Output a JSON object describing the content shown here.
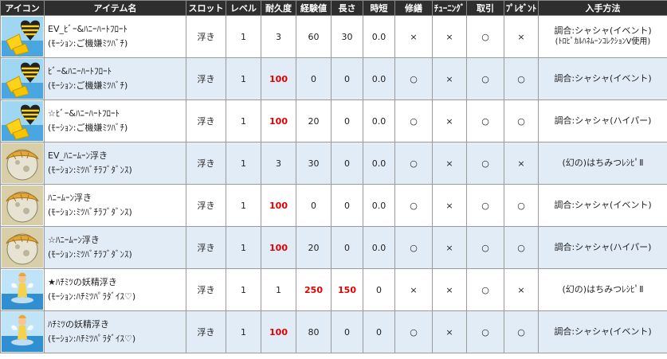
{
  "headers": [
    "アイコン",
    "アイテム名",
    "スロット",
    "レベル",
    "耐久度",
    "経験値",
    "長さ",
    "時短",
    "修繕",
    "ﾁｭｰﾆﾝｸﾞ",
    "取引",
    "ﾌﾟﾚｾﾞﾝﾄ",
    "入手方法"
  ],
  "rows": [
    {
      "icon": "heart-float-icon",
      "name1": "EV_ﾋﾞｰ&ﾊﾆｰﾊｰﾄﾌﾛｰﾄ",
      "name2": "(ﾓｰｼｮﾝ:ご機嫌ﾐﾂﾊﾞﾁ)",
      "slot": "浮き",
      "level": "1",
      "durability": "3",
      "exp": "60",
      "length": "30",
      "time": "0.0",
      "repair": "×",
      "tuning": "×",
      "trade": "○",
      "present": "×",
      "how": "調合:シャシャ(イベント)",
      "how2": "(ﾄﾛﾋﾟｶﾙﾊﾈﾑｰﾝｺﾚｸｼｮﾝⅤ使用)",
      "dur_red": false,
      "exp_red": false,
      "len_red": false
    },
    {
      "icon": "heart-float-icon",
      "name1": "ﾋﾞｰ&ﾊﾆｰﾊｰﾄﾌﾛｰﾄ",
      "name2": "(ﾓｰｼｮﾝ:ご機嫌ﾐﾂﾊﾞﾁ)",
      "slot": "浮き",
      "level": "1",
      "durability": "100",
      "exp": "0",
      "length": "0",
      "time": "0.0",
      "repair": "○",
      "tuning": "×",
      "trade": "○",
      "present": "○",
      "how": "調合:シャシャ(イベント)",
      "how2": "",
      "dur_red": true,
      "exp_red": false,
      "len_red": false
    },
    {
      "icon": "heart-float-icon",
      "name1": "☆ﾋﾞｰ&ﾊﾆｰﾊｰﾄﾌﾛｰﾄ",
      "name2": "(ﾓｰｼｮﾝ:ご機嫌ﾐﾂﾊﾞﾁ)",
      "slot": "浮き",
      "level": "1",
      "durability": "100",
      "exp": "20",
      "length": "0",
      "time": "0.0",
      "repair": "○",
      "tuning": "×",
      "trade": "○",
      "present": "○",
      "how": "調合:シャシャ(ハイパー)",
      "how2": "",
      "dur_red": true,
      "exp_red": false,
      "len_red": false
    },
    {
      "icon": "honeymoon-float-icon",
      "name1": "EV_ﾊﾆｰﾑｰﾝ浮き",
      "name2": "(ﾓｰｼｮﾝ:ﾐﾂﾊﾞﾁﾗﾌﾞﾀﾞﾝｽ)",
      "slot": "浮き",
      "level": "1",
      "durability": "3",
      "exp": "30",
      "length": "0",
      "time": "0.0",
      "repair": "○",
      "tuning": "×",
      "trade": "○",
      "present": "×",
      "how": "(幻の)はちみつﾚｼﾋﾟⅡ",
      "how2": "",
      "dur_red": false,
      "exp_red": false,
      "len_red": false
    },
    {
      "icon": "honeymoon-float-icon",
      "name1": "ﾊﾆｰﾑｰﾝ浮き",
      "name2": "(ﾓｰｼｮﾝ:ﾐﾂﾊﾞﾁﾗﾌﾞﾀﾞﾝｽ)",
      "slot": "浮き",
      "level": "1",
      "durability": "100",
      "exp": "0",
      "length": "0",
      "time": "0.0",
      "repair": "○",
      "tuning": "×",
      "trade": "○",
      "present": "○",
      "how": "調合:シャシャ(イベント)",
      "how2": "",
      "dur_red": true,
      "exp_red": false,
      "len_red": false
    },
    {
      "icon": "honeymoon-float-icon",
      "name1": "☆ﾊﾆｰﾑｰﾝ浮き",
      "name2": "(ﾓｰｼｮﾝ:ﾐﾂﾊﾞﾁﾗﾌﾞﾀﾞﾝｽ)",
      "slot": "浮き",
      "level": "1",
      "durability": "100",
      "exp": "20",
      "length": "0",
      "time": "0.0",
      "repair": "○",
      "tuning": "×",
      "trade": "○",
      "present": "○",
      "how": "調合:シャシャ(ハイパー)",
      "how2": "",
      "dur_red": true,
      "exp_red": false,
      "len_red": false
    },
    {
      "icon": "fairy-float-icon",
      "name1": "★ﾊﾁﾐﾂの妖精浮き",
      "name2": "(ﾓｰｼｮﾝ:ﾊﾁﾐﾂﾊﾟﾗﾀﾞｲｽ♡)",
      "slot": "浮き",
      "level": "1",
      "durability": "1",
      "exp": "250",
      "length": "150",
      "time": "0",
      "repair": "×",
      "tuning": "×",
      "trade": "○",
      "present": "×",
      "how": "(幻の)はちみつﾚｼﾋﾟⅡ",
      "how2": "",
      "dur_red": false,
      "exp_red": true,
      "len_red": true
    },
    {
      "icon": "fairy-float-icon",
      "name1": "ﾊﾁﾐﾂの妖精浮き",
      "name2": "(ﾓｰｼｮﾝ:ﾊﾁﾐﾂﾊﾟﾗﾀﾞｲｽ♡)",
      "slot": "浮き",
      "level": "1",
      "durability": "100",
      "exp": "80",
      "length": "0",
      "time": "0",
      "repair": "○",
      "tuning": "×",
      "trade": "○",
      "present": "○",
      "how": "調合:シャシャ(イベント)",
      "how2": "",
      "dur_red": true,
      "exp_red": false,
      "len_red": false
    }
  ]
}
